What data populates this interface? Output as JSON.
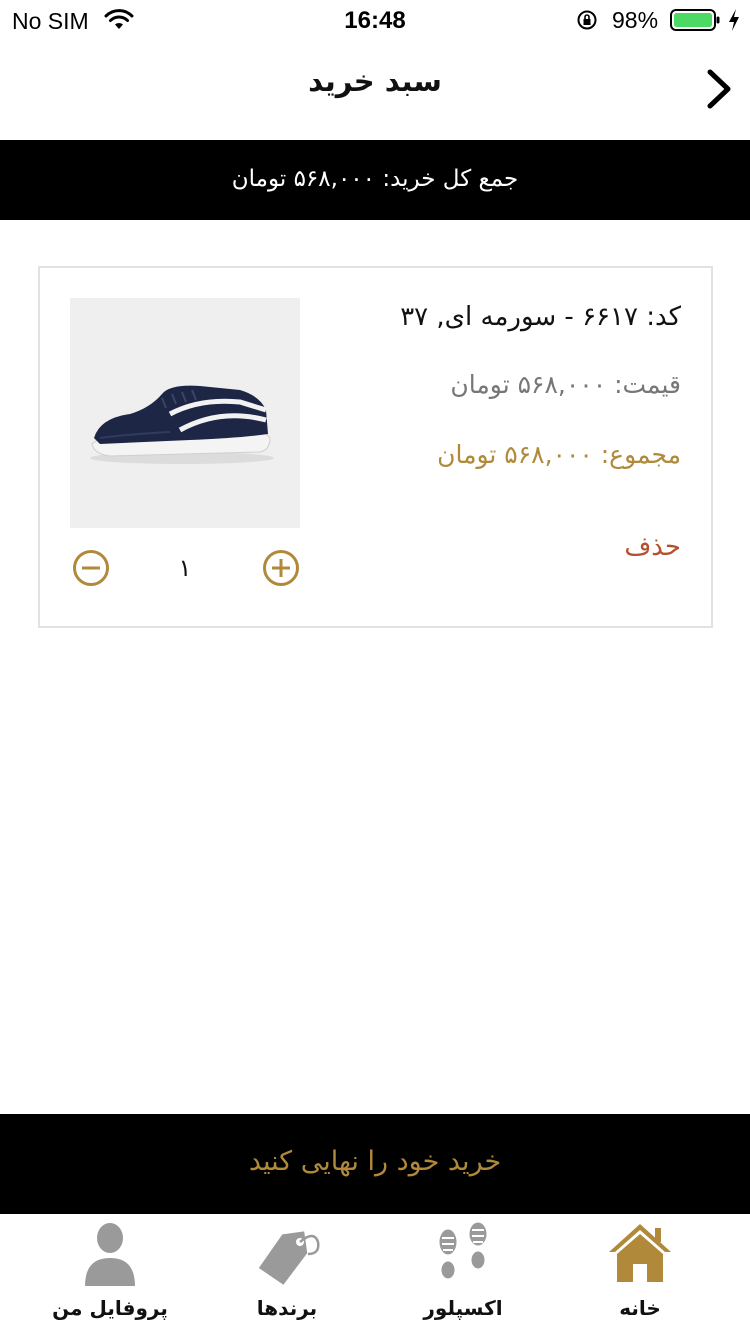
{
  "status_bar": {
    "carrier": "No SIM",
    "time": "16:48",
    "battery": "98%"
  },
  "nav": {
    "title": "سبد خرید"
  },
  "cart_total": {
    "text": "جمع کل خرید: ۵۶۸,۰۰۰ تومان"
  },
  "item": {
    "code": "کد: ۶۶۱۷ - سورمه ای, ۳۷",
    "price": "قیمت: ۵۶۸,۰۰۰ تومان",
    "sum": "مجموع: ۵۶۸,۰۰۰ تومان",
    "delete_label": "حذف",
    "quantity": "۱"
  },
  "checkout": {
    "label": "خرید خود را نهایی کنید"
  },
  "tabs": [
    {
      "label": "خانه",
      "icon": "home-icon"
    },
    {
      "label": "اکسپلور",
      "icon": "footprints-icon"
    },
    {
      "label": "برندها",
      "icon": "tag-icon"
    },
    {
      "label": "پروفایل من",
      "icon": "user-icon"
    }
  ],
  "colors": {
    "accent_gold": "#b08a3a",
    "delete_red": "#b5502a",
    "inactive_icon": "#9a9a9a",
    "bar_black": "#000000",
    "battery_green": "#4cd964"
  }
}
